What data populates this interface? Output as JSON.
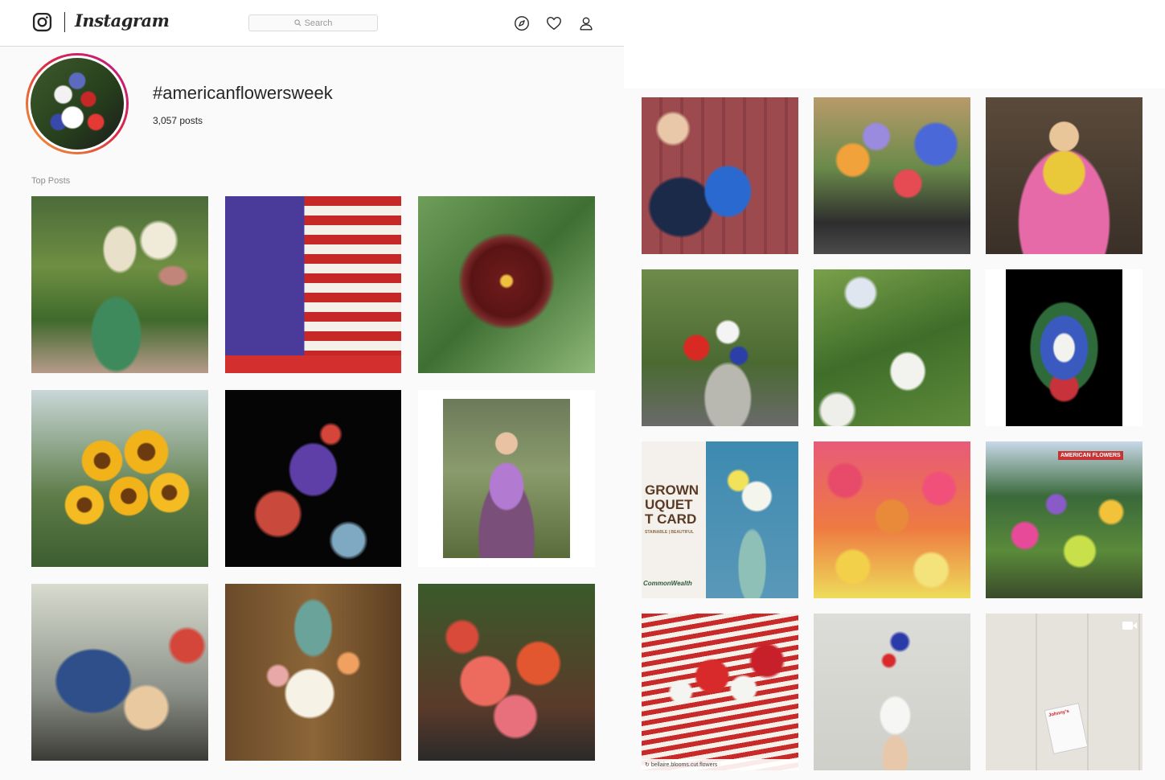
{
  "app": {
    "wordmark": "Instagram"
  },
  "search": {
    "placeholder": "Search"
  },
  "nav": {
    "icons": [
      "compass-icon",
      "heart-icon",
      "profile-icon"
    ]
  },
  "hashtag": {
    "title": "#americanflowersweek",
    "posts_count": "3,057",
    "posts_label": "posts"
  },
  "top_posts": {
    "label": "Top Posts"
  },
  "tiles": {
    "bouquet_card_lines": [
      "GROWN",
      "UQUET",
      "T CARD"
    ],
    "bouquet_card_tagline": "STAINABLE | BEAUTIFUL",
    "bouquet_card_brand": "CommonWealth",
    "repost_caption": "bellaire.blooms.cut.flowers",
    "market_sign": "AMERICAN FLOWERS",
    "seed_packet_brand": "Johnny's"
  },
  "colors": {
    "ring_gradient": [
      "#f09433",
      "#dc2743",
      "#bc1888"
    ],
    "border": "#dbdbdb",
    "muted_text": "#8e8e8e"
  }
}
